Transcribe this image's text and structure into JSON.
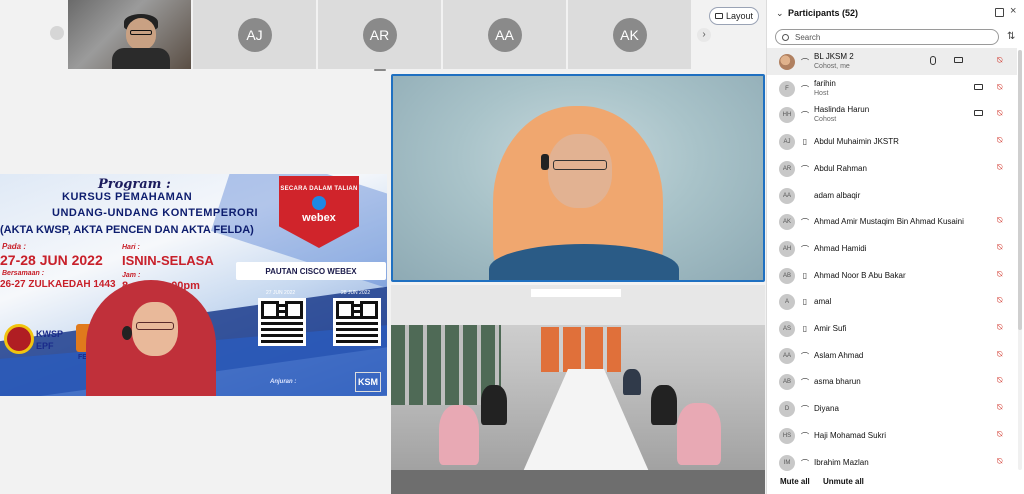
{
  "layout_button": {
    "label": "Layout",
    "icon": "layout-icon"
  },
  "filmstrip": {
    "tiles": [
      {
        "type": "video"
      },
      {
        "type": "avatar",
        "initials": "AJ"
      },
      {
        "type": "avatar",
        "initials": "AR"
      },
      {
        "type": "avatar",
        "initials": "AA"
      },
      {
        "type": "avatar",
        "initials": "AK"
      }
    ]
  },
  "poster": {
    "program": "Program :",
    "title1": "KURSUS PEMAHAMAN",
    "title2": "UNDANG-UNDANG KONTEMPERORI",
    "title3": "(AKTA KWSP, AKTA PENCEN DAN AKTA FELDA)",
    "pada_label": "Pada :",
    "date": "27-28 JUN 2022",
    "bersamaan_label": "Bersamaan :",
    "hijri": "26-27 ZULKAEDAH 1443",
    "hari_label": "Hari :",
    "hari": "ISNIN-SELASA",
    "jam_label": "Jam :",
    "jam": "8.",
    "jam_end": "00pm",
    "badge_line": "SECARA DALAM TALIAN",
    "badge_name": "webex",
    "pautan": "PAUTAN CISCO WEBEX",
    "qr1_date": "27 JUN 2022",
    "qr2_date": "28 JUN 2022",
    "kwsp": "KWSP",
    "epf": "EPF",
    "felda": "FELDA",
    "ksm": "KSM",
    "anjuran": "Anjuran :"
  },
  "panel": {
    "title": "Participants (52)",
    "search_placeholder": "Search",
    "footer": {
      "mute_all": "Mute all",
      "unmute_all": "Unmute all"
    },
    "participants": [
      {
        "initials": "",
        "avatar_img": true,
        "name": "BL JKSM 2",
        "role": "Cohost, me",
        "device": "headset",
        "share": true,
        "camera": true,
        "selected": true
      },
      {
        "initials": "F",
        "name": "farihin",
        "role": "Host",
        "device": "headset",
        "camera_outline": true
      },
      {
        "initials": "HH",
        "name": "Haslinda Harun",
        "role": "Cohost",
        "device": "headset",
        "camera_outline": true
      },
      {
        "initials": "AJ",
        "name": "Abdul Muhaimin JKSTR",
        "role": "",
        "device": "phone"
      },
      {
        "initials": "AR",
        "name": "Abdul Rahman",
        "role": "",
        "device": "headset"
      },
      {
        "initials": "AA",
        "name": "adam albaqir",
        "role": "",
        "device": "",
        "no_mute": true
      },
      {
        "initials": "AK",
        "name": "Ahmad Amir Mustaqim Bin Ahmad Kusaini",
        "role": "",
        "device": "headset"
      },
      {
        "initials": "AH",
        "name": "Ahmad Hamidi",
        "role": "",
        "device": "headset"
      },
      {
        "initials": "AB",
        "name": "Ahmad Noor B Abu Bakar",
        "role": "",
        "device": "phone"
      },
      {
        "initials": "A",
        "name": "amal",
        "role": "",
        "device": "phone"
      },
      {
        "initials": "AS",
        "name": "Amir Sufi",
        "role": "",
        "device": "phone"
      },
      {
        "initials": "AA",
        "name": "Aslam Ahmad",
        "role": "",
        "device": "headset"
      },
      {
        "initials": "AB",
        "name": "asma bharun",
        "role": "",
        "device": "headset"
      },
      {
        "initials": "D",
        "name": "Diyana",
        "role": "",
        "device": "headset"
      },
      {
        "initials": "HS",
        "name": "Haji Mohamad Sukri",
        "role": "",
        "device": "headset"
      },
      {
        "initials": "IM",
        "name": "Ibrahim Mazlan",
        "role": "",
        "device": "headset"
      }
    ]
  }
}
